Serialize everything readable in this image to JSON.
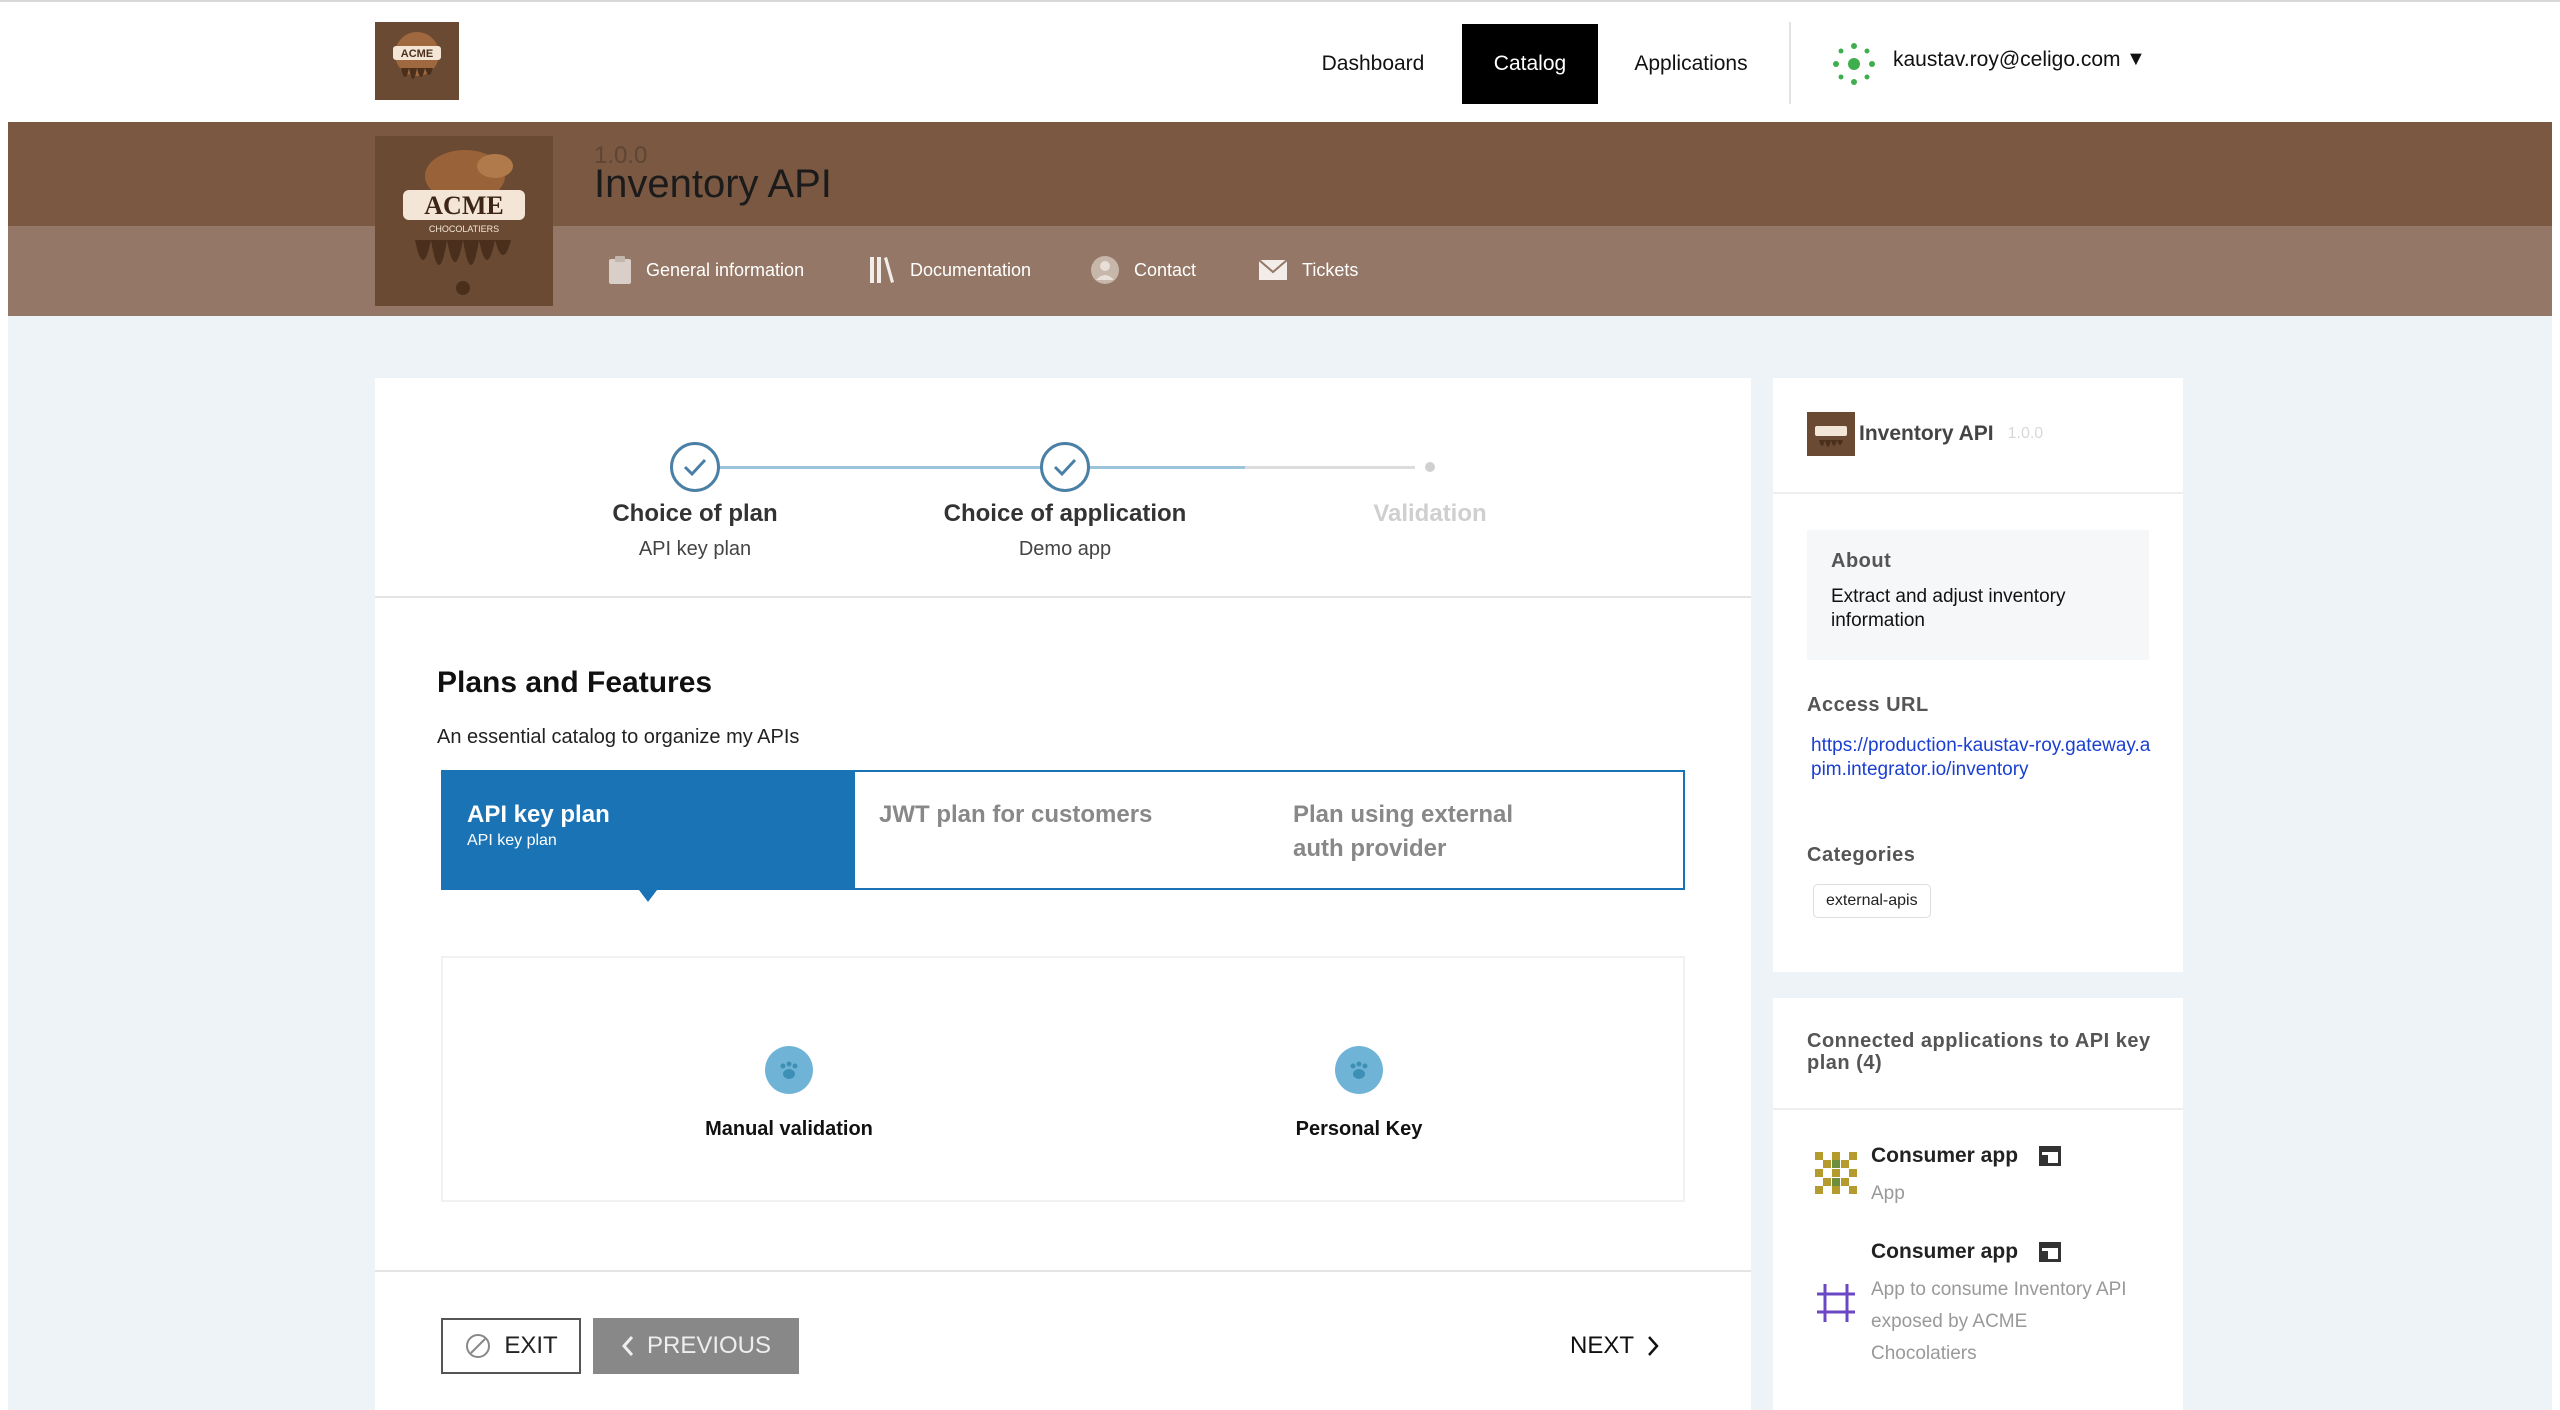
{
  "topnav": {
    "logo_name": "acme-logo",
    "items": [
      {
        "label": "Dashboard",
        "active": false
      },
      {
        "label": "Catalog",
        "active": true
      },
      {
        "label": "Applications",
        "active": false
      }
    ],
    "user_email": "kaustav.roy@celigo.com",
    "caret": "▼"
  },
  "api": {
    "version": "1.0.0",
    "title": "Inventory API",
    "tabs": [
      {
        "label": "General information",
        "icon": "clipboard-icon"
      },
      {
        "label": "Documentation",
        "icon": "books-icon"
      },
      {
        "label": "Contact",
        "icon": "person-icon"
      },
      {
        "label": "Tickets",
        "icon": "envelope-icon"
      }
    ]
  },
  "stepper": {
    "steps": [
      {
        "title": "Choice of plan",
        "sub": "API key plan",
        "state": "done"
      },
      {
        "title": "Choice of application",
        "sub": "Demo app",
        "state": "done"
      },
      {
        "title": "Validation",
        "sub": "",
        "state": "todo"
      }
    ]
  },
  "plans": {
    "title": "Plans and Features",
    "subtitle": "An essential catalog to organize my APIs",
    "items": [
      {
        "name": "API key plan",
        "sub": "API key plan",
        "active": true
      },
      {
        "name": "JWT plan for customers",
        "sub": "",
        "active": false
      },
      {
        "name": "Plan using external auth provider",
        "sub": "",
        "active": false
      }
    ],
    "features": [
      {
        "label": "Manual validation"
      },
      {
        "label": "Personal Key"
      }
    ]
  },
  "footer": {
    "exit_label": "EXIT",
    "previous_label": "PREVIOUS",
    "next_label": "NEXT"
  },
  "sidebar": {
    "api_name": "Inventory API",
    "api_version": "1.0.0",
    "about_label": "About",
    "about_text": "Extract and adjust inventory information",
    "access_url_label": "Access URL",
    "access_url": "https://production-kaustav-roy.gateway.apim.integrator.io/inventory",
    "categories_label": "Categories",
    "categories": [
      "external-apis"
    ]
  },
  "connected_apps": {
    "title": "Connected applications to API key plan (4)",
    "apps": [
      {
        "name": "Consumer app",
        "desc": "App"
      },
      {
        "name": "Consumer app",
        "desc": "App to consume Inventory API exposed by ACME Chocolatiers"
      }
    ]
  },
  "colors": {
    "header_brown": "#7a5841",
    "header_band": "#947766",
    "accent_blue": "#1a73b5",
    "page_bg": "#eef3f8"
  }
}
